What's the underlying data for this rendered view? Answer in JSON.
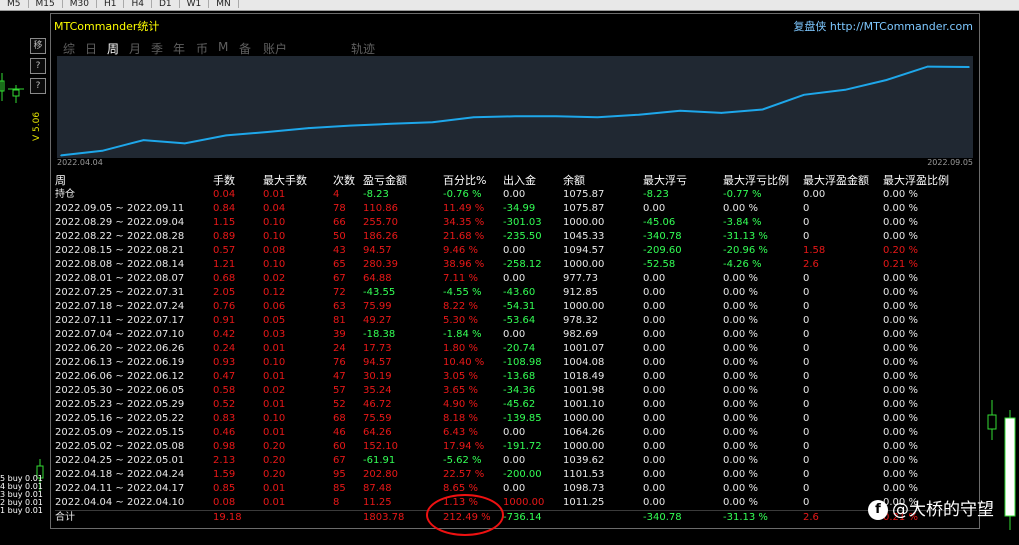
{
  "timeframes": [
    "M5",
    "M15",
    "M30",
    "H1",
    "H4",
    "D1",
    "W1",
    "MN"
  ],
  "side": {
    "vertical_label": "V 5.06",
    "buy_labels": [
      "5 buy 0.01",
      "4 buy 0.01",
      "3 buy 0.01",
      "2 buy 0.01",
      "1 buy 0.01"
    ]
  },
  "window": {
    "title": "MTCommander统计",
    "site": "复盘侠 http://MTCommander.com",
    "side_buttons": [
      "移",
      "?",
      "?"
    ]
  },
  "tabs": [
    {
      "label": "综"
    },
    {
      "label": "日"
    },
    {
      "label": "周",
      "active": true
    },
    {
      "label": "月"
    },
    {
      "label": "季"
    },
    {
      "label": "年"
    },
    {
      "label": "币"
    },
    {
      "label": "M"
    },
    {
      "label": "备"
    },
    {
      "label": "账户"
    },
    {
      "label": "轨迹"
    }
  ],
  "chart_data": {
    "type": "line",
    "x_start_label": "2022.04.04",
    "x_end_label": "2022.09.05",
    "x": [
      "2022.04.04",
      "2022.04.11",
      "2022.04.18",
      "2022.04.25",
      "2022.05.02",
      "2022.05.09",
      "2022.05.16",
      "2022.05.23",
      "2022.05.30",
      "2022.06.06",
      "2022.06.13",
      "2022.06.20",
      "2022.06.27",
      "2022.07.04",
      "2022.07.11",
      "2022.07.18",
      "2022.07.25",
      "2022.08.01",
      "2022.08.08",
      "2022.08.15",
      "2022.08.22",
      "2022.08.29",
      "2022.09.05"
    ],
    "values": [
      11.25,
      98.73,
      301.53,
      239.62,
      391.34,
      455.6,
      531.19,
      577.91,
      613.15,
      643.34,
      737.91,
      755.64,
      755.64,
      737.26,
      786.53,
      862.52,
      818.97,
      883.85,
      1164.24,
      1258.81,
      1445.07,
      1700.77,
      1692.54
    ],
    "ylim": [
      0,
      1750
    ],
    "color": "#1ea7ea"
  },
  "table": {
    "columns": [
      "周",
      "手数",
      "最大手数",
      "次数",
      "盈亏金额",
      "百分比%",
      "出入金",
      "余额",
      "最大浮亏",
      "最大浮亏比例",
      "最大浮盈金额",
      "最大浮盈比例"
    ],
    "rows": [
      [
        "持仓",
        "0.04",
        "0.01",
        "4",
        "-8.23",
        "-0.76 %",
        "0.00",
        "1075.87",
        "-8.23",
        "-0.77 %",
        "0.00",
        "0.00 %"
      ],
      [
        "2022.09.05 ~ 2022.09.11",
        "0.84",
        "0.04",
        "78",
        "110.86",
        "11.49 %",
        "-34.99",
        "1075.87",
        "0.00",
        "0.00 %",
        "0",
        "0.00 %"
      ],
      [
        "2022.08.29 ~ 2022.09.04",
        "1.15",
        "0.10",
        "66",
        "255.70",
        "34.35 %",
        "-301.03",
        "1000.00",
        "-45.06",
        "-3.84 %",
        "0",
        "0.00 %"
      ],
      [
        "2022.08.22 ~ 2022.08.28",
        "0.89",
        "0.10",
        "50",
        "186.26",
        "21.68 %",
        "-235.50",
        "1045.33",
        "-340.78",
        "-31.13 %",
        "0",
        "0.00 %"
      ],
      [
        "2022.08.15 ~ 2022.08.21",
        "0.57",
        "0.08",
        "43",
        "94.57",
        "9.46 %",
        "0.00",
        "1094.57",
        "-209.60",
        "-20.96 %",
        "1.58",
        "0.20 %"
      ],
      [
        "2022.08.08 ~ 2022.08.14",
        "1.21",
        "0.10",
        "65",
        "280.39",
        "38.96 %",
        "-258.12",
        "1000.00",
        "-52.58",
        "-4.26 %",
        "2.6",
        "0.21 %"
      ],
      [
        "2022.08.01 ~ 2022.08.07",
        "0.68",
        "0.02",
        "67",
        "64.88",
        "7.11 %",
        "0.00",
        "977.73",
        "0.00",
        "0.00 %",
        "0",
        "0.00 %"
      ],
      [
        "2022.07.25 ~ 2022.07.31",
        "2.05",
        "0.12",
        "72",
        "-43.55",
        "-4.55 %",
        "-43.60",
        "912.85",
        "0.00",
        "0.00 %",
        "0",
        "0.00 %"
      ],
      [
        "2022.07.18 ~ 2022.07.24",
        "0.76",
        "0.06",
        "63",
        "75.99",
        "8.22 %",
        "-54.31",
        "1000.00",
        "0.00",
        "0.00 %",
        "0",
        "0.00 %"
      ],
      [
        "2022.07.11 ~ 2022.07.17",
        "0.91",
        "0.05",
        "81",
        "49.27",
        "5.30 %",
        "-53.64",
        "978.32",
        "0.00",
        "0.00 %",
        "0",
        "0.00 %"
      ],
      [
        "2022.07.04 ~ 2022.07.10",
        "0.42",
        "0.03",
        "39",
        "-18.38",
        "-1.84 %",
        "0.00",
        "982.69",
        "0.00",
        "0.00 %",
        "0",
        "0.00 %"
      ],
      [
        "2022.06.20 ~ 2022.06.26",
        "0.24",
        "0.01",
        "24",
        "17.73",
        "1.80 %",
        "-20.74",
        "1001.07",
        "0.00",
        "0.00 %",
        "0",
        "0.00 %"
      ],
      [
        "2022.06.13 ~ 2022.06.19",
        "0.93",
        "0.10",
        "76",
        "94.57",
        "10.40 %",
        "-108.98",
        "1004.08",
        "0.00",
        "0.00 %",
        "0",
        "0.00 %"
      ],
      [
        "2022.06.06 ~ 2022.06.12",
        "0.47",
        "0.01",
        "47",
        "30.19",
        "3.05 %",
        "-13.68",
        "1018.49",
        "0.00",
        "0.00 %",
        "0",
        "0.00 %"
      ],
      [
        "2022.05.30 ~ 2022.06.05",
        "0.58",
        "0.02",
        "57",
        "35.24",
        "3.65 %",
        "-34.36",
        "1001.98",
        "0.00",
        "0.00 %",
        "0",
        "0.00 %"
      ],
      [
        "2022.05.23 ~ 2022.05.29",
        "0.52",
        "0.01",
        "52",
        "46.72",
        "4.90 %",
        "-45.62",
        "1001.10",
        "0.00",
        "0.00 %",
        "0",
        "0.00 %"
      ],
      [
        "2022.05.16 ~ 2022.05.22",
        "0.83",
        "0.10",
        "68",
        "75.59",
        "8.18 %",
        "-139.85",
        "1000.00",
        "0.00",
        "0.00 %",
        "0",
        "0.00 %"
      ],
      [
        "2022.05.09 ~ 2022.05.15",
        "0.46",
        "0.01",
        "46",
        "64.26",
        "6.43 %",
        "0.00",
        "1064.26",
        "0.00",
        "0.00 %",
        "0",
        "0.00 %"
      ],
      [
        "2022.05.02 ~ 2022.05.08",
        "0.98",
        "0.20",
        "60",
        "152.10",
        "17.94 %",
        "-191.72",
        "1000.00",
        "0.00",
        "0.00 %",
        "0",
        "0.00 %"
      ],
      [
        "2022.04.25 ~ 2022.05.01",
        "2.13",
        "0.20",
        "67",
        "-61.91",
        "-5.62 %",
        "0.00",
        "1039.62",
        "0.00",
        "0.00 %",
        "0",
        "0.00 %"
      ],
      [
        "2022.04.18 ~ 2022.04.24",
        "1.59",
        "0.20",
        "95",
        "202.80",
        "22.57 %",
        "-200.00",
        "1101.53",
        "0.00",
        "0.00 %",
        "0",
        "0.00 %"
      ],
      [
        "2022.04.11 ~ 2022.04.17",
        "0.85",
        "0.01",
        "85",
        "87.48",
        "8.65 %",
        "0.00",
        "1098.73",
        "0.00",
        "0.00 %",
        "0",
        "0.00 %"
      ],
      [
        "2022.04.04 ~ 2022.04.10",
        "0.08",
        "0.01",
        "8",
        "11.25",
        "1.13 %",
        "1000.00",
        "1011.25",
        "0.00",
        "0.00 %",
        "0",
        "0.00 %"
      ]
    ],
    "total": [
      "合计",
      "19.18",
      "",
      "",
      "1803.78",
      "212.49 %",
      "-736.14",
      "",
      "-340.78",
      "-31.13 %",
      "2.6",
      "0.21 %"
    ]
  },
  "watermark": {
    "logo": "f",
    "text": "@大桥的守望"
  }
}
